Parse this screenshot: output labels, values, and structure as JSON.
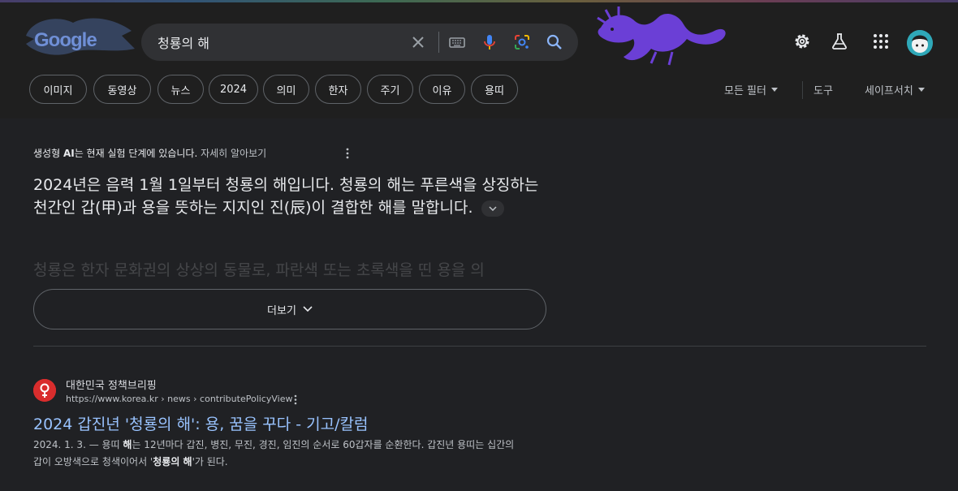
{
  "header": {
    "logo_text": "Google",
    "search": {
      "value": "청룡의 해",
      "placeholder": ""
    },
    "icons": [
      "close-icon",
      "keyboard-icon",
      "mic-icon",
      "lens-icon",
      "search-icon",
      "gear-icon",
      "labs-flask-icon",
      "apps-grid-icon",
      "avatar"
    ]
  },
  "chips": [
    "이미지",
    "동영상",
    "뉴스",
    "2024",
    "의미",
    "한자",
    "주기",
    "이유",
    "용띠"
  ],
  "tools": {
    "all_filters": "모든 필터",
    "tools": "도구",
    "safesearch": "세이프서치"
  },
  "ai_overview": {
    "head_prefix": "생성형 ",
    "head_bold": "AI",
    "head_suffix": "는 현재 실험 단계에 있습니다.",
    "learn_more": "자세히 알아보기",
    "text": "2024년은 음력 1월 1일부터 청룡의 해입니다. 청룡의 해는 푸른색을 상징하는 천간인 갑(甲)과 용을 뜻하는 지지인 진(辰)이 결합한 해를 말합니다.",
    "faded_text": "청룡은 한자 문화권의 상상의 동물로, 파란색 또는 초록색을 띤 용을 의",
    "more_button": "더보기"
  },
  "result": {
    "site_name": "대한민국 정책브리핑",
    "url": "https://www.korea.kr › news › contributePolicyView",
    "title": "2024 갑진년 '청룡의 해': 용, 꿈을 꾸다 - 기고/칼럼",
    "snippet": {
      "date": "2024. 1. 3. — 용띠 ",
      "b1": "해",
      "part2": "는 12년마다 갑진, 병진, 무진, 경진, 임진의 순서로 60갑자를 순환한다. 갑진년 용띠는 십간의 갑이 오방색으로 청색이어서 '",
      "b2": "청룡의 해",
      "part3": "'가 된다."
    }
  },
  "colors": {
    "background": "#202124",
    "link": "#99c3ff",
    "text": "#e8eaed",
    "dragon": "#6b3fd6"
  }
}
